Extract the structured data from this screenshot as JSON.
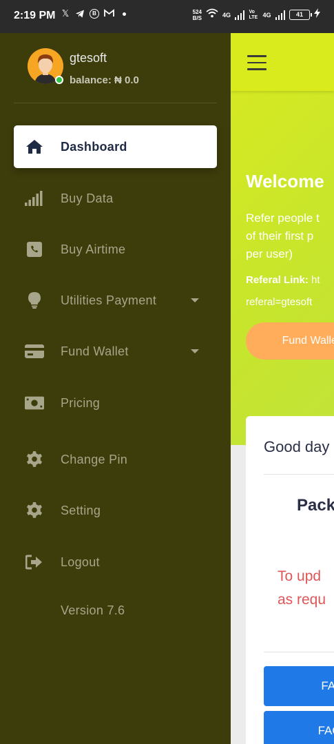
{
  "status_bar": {
    "time": "2:19 PM",
    "left_icons": [
      "x-icon",
      "telegram-icon",
      "b-circle-icon",
      "gmail-icon",
      "dot-icon"
    ],
    "speed_value": "524",
    "speed_unit": "B/S",
    "network_1": "4G",
    "network_volte": "Vo LTE",
    "network_2": "4G",
    "battery": "41"
  },
  "sidebar": {
    "username": "gtesoft",
    "balance": "balance: ₦ 0.0",
    "items": [
      {
        "label": "Dashboard",
        "icon": "home-icon",
        "active": true
      },
      {
        "label": "Buy Data",
        "icon": "signal-bars-icon"
      },
      {
        "label": "Buy Airtime",
        "icon": "phone-square-icon"
      },
      {
        "label": "Utilities Payment",
        "icon": "lightbulb-icon",
        "has_dropdown": true
      },
      {
        "label": "Fund Wallet",
        "icon": "credit-card-icon",
        "has_dropdown": true
      },
      {
        "label": "Pricing",
        "icon": "money-bill-icon"
      },
      {
        "label": "Change Pin",
        "icon": "gear-icon"
      },
      {
        "label": "Setting",
        "icon": "gear-icon"
      },
      {
        "label": "Logout",
        "icon": "sign-out-icon"
      }
    ],
    "version": "Version 7.6"
  },
  "main": {
    "welcome": "Welcome",
    "refer_line1": "Refer people t",
    "refer_line2": "of their first p",
    "refer_line3": "per user)",
    "referal_label": "Referal Link:",
    "referal_link_partial": "ht",
    "referal_param": "referal=gtesoft",
    "fund_wallet_button": "Fund Wallet",
    "card": {
      "greeting": "Good day",
      "package_heading": "Pack",
      "warning_line1": "To upd",
      "warning_line2": "as requ",
      "faq_1": "FAQ reg",
      "faq_2": "FAQ rega"
    }
  },
  "colors": {
    "sidebar_bg": "#3d3c0b",
    "hero_yellow_green": "#d8ea20",
    "fund_button_orange": "#ffad5a",
    "faq_button_blue": "#1f79e6",
    "warning_red": "#e05656",
    "online_green": "#35c24a"
  }
}
